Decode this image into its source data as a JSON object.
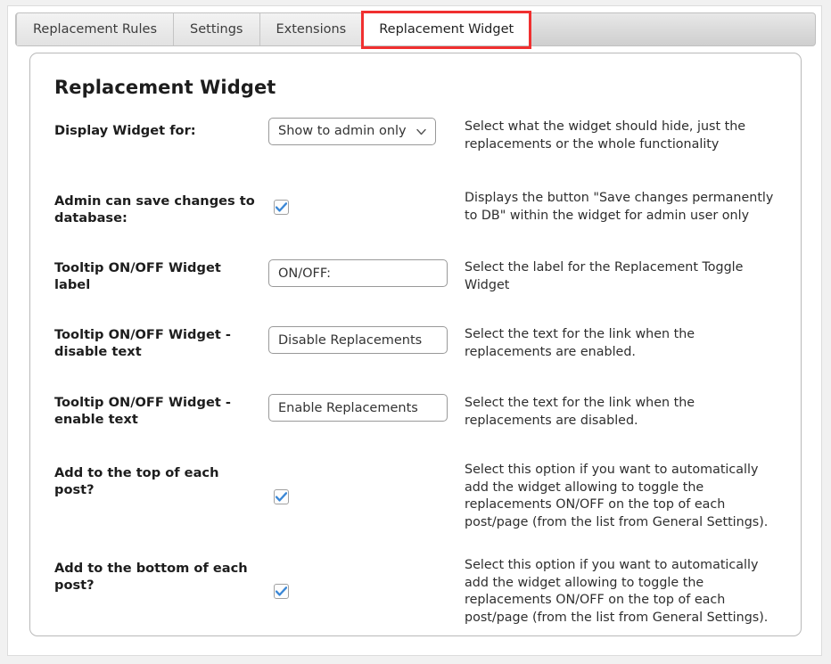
{
  "window": {
    "tabs": [
      {
        "label": "Replacement Rules",
        "active": false
      },
      {
        "label": "Settings",
        "active": false
      },
      {
        "label": "Extensions",
        "active": false
      },
      {
        "label": "Replacement Widget",
        "active": true
      }
    ],
    "annotation_color": "#f03030"
  },
  "card": {
    "title": "Replacement Widget",
    "rows": [
      {
        "label": "Display Widget for:",
        "control": "select",
        "value": "Show to admin only",
        "options": [
          "Show to admin only"
        ],
        "description": "Select what the widget should hide, just the replacements or the whole functionality"
      },
      {
        "label": "Admin can save changes to database:",
        "control": "checkbox",
        "checked": true,
        "description": "Displays the button \"Save changes permanently to DB\" within the widget for admin user only"
      },
      {
        "label": "Tooltip ON/OFF Widget label",
        "control": "text",
        "value": "ON/OFF:",
        "description": "Select the label for the Replacement Toggle Widget"
      },
      {
        "label": "Tooltip ON/OFF Widget - disable text",
        "control": "text",
        "value": "Disable Replacements",
        "description": "Select the text for the link when the replacements are enabled."
      },
      {
        "label": "Tooltip ON/OFF Widget - enable text",
        "control": "text",
        "value": "Enable Replacements",
        "description": "Select the text for the link when the replacements are disabled."
      },
      {
        "label": "Add to the top of each post?",
        "control": "checkbox",
        "checked": true,
        "description": "Select this option if you want to automatically add the widget allowing to toggle the replacements ON/OFF on the top of each post/page (from the list from General Settings)."
      },
      {
        "label": "Add to the bottom of each post?",
        "control": "checkbox",
        "checked": true,
        "description": "Select this option if you want to automatically add the widget allowing to toggle the replacements ON/OFF on the top of each post/page (from the list from General Settings)."
      }
    ]
  },
  "icons": {
    "chevron_down": "chevron-down-icon",
    "checkmark": "checkmark-icon"
  }
}
